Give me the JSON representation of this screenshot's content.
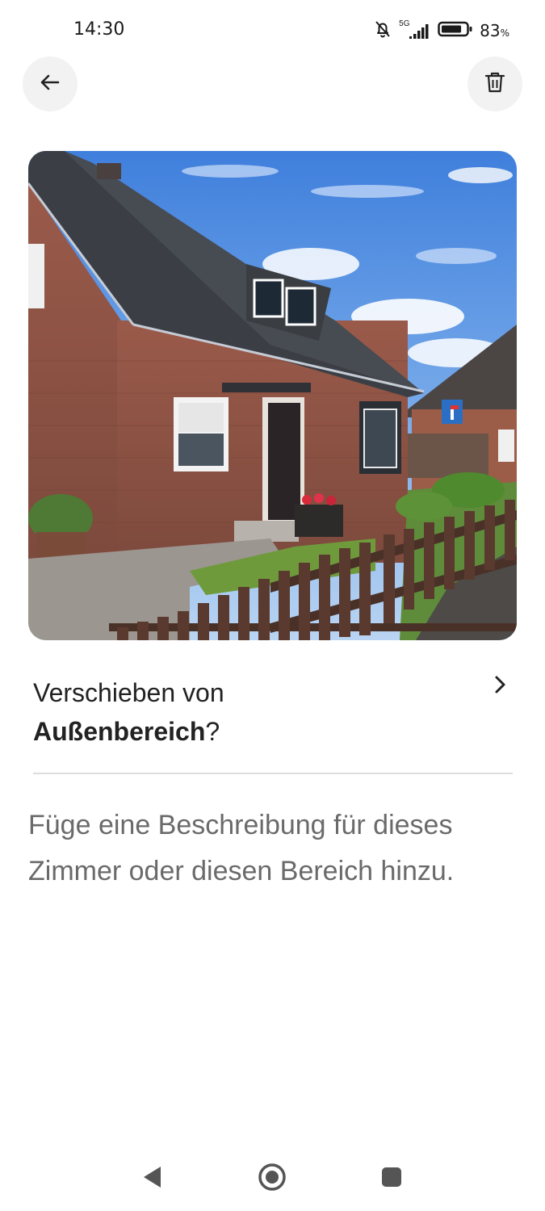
{
  "status_bar": {
    "time": "14:30",
    "network": "5G",
    "battery_percent": "83",
    "battery_unit": "%",
    "battery_level": 0.83
  },
  "header": {
    "back_icon": "arrow-left-icon",
    "delete_icon": "trash-icon"
  },
  "photo": {
    "subject": "house-exterior-photo"
  },
  "move": {
    "prefix": "Verschieben von ",
    "room": "Außenbereich",
    "suffix": "?",
    "chevron_icon": "chevron-right-icon"
  },
  "description": {
    "placeholder": "Füge eine Beschreibung für dieses Zimmer oder diesen Bereich hinzu."
  },
  "nav_bar": {
    "back_icon": "triangle-back-icon",
    "home_icon": "circle-home-icon",
    "recents_icon": "square-recents-icon"
  },
  "colors": {
    "text_primary": "#222222",
    "text_secondary": "#6a6a6a",
    "button_bg": "#f2f2f2",
    "divider": "#dddddd"
  }
}
